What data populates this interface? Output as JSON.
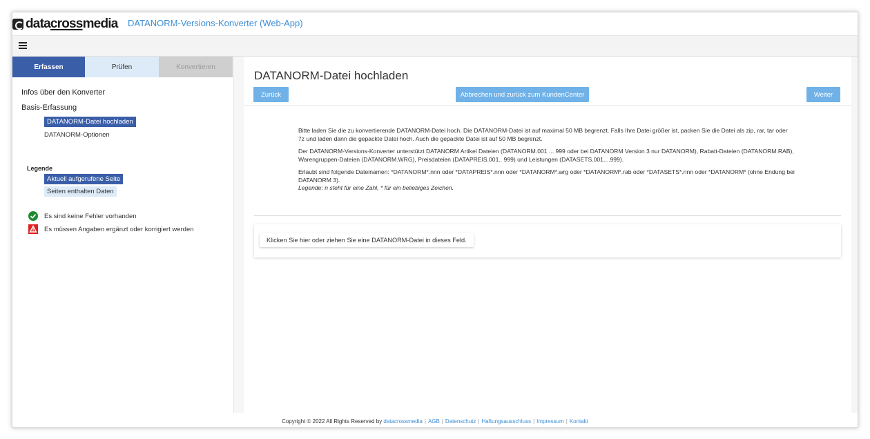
{
  "header": {
    "logo_part1": "data",
    "logo_part2": "cross",
    "logo_part3": "media",
    "app_title": "DATANORM-Versions-Konverter (Web-App)"
  },
  "sidebar": {
    "tabs": [
      {
        "label": "Erfassen",
        "state": "active"
      },
      {
        "label": "Prüfen",
        "state": "normal"
      },
      {
        "label": "Konvertieren",
        "state": "disabled"
      }
    ],
    "section1": "Infos über den Konverter",
    "section2": "Basis-Erfassung",
    "nav_active": "DATANORM-Datei hochladen",
    "nav_item": "DATANORM-Optionen",
    "legend": {
      "title": "Legende",
      "current_page": "Aktuell aufgerufene Seite",
      "pages_data": "Seiten enthalten Daten",
      "no_errors": "Es sind keine Fehler vorhanden",
      "must_fix": "Es müssen Angaben ergänzt oder korrigiert werden"
    }
  },
  "main": {
    "title": "DATANORM-Datei hochladen",
    "buttons": {
      "back": "Zurück",
      "cancel": "Abbrechen und zurück zum KundenCenter",
      "next": "Weiter"
    },
    "info": {
      "p1": "Bitte laden Sie die zu konvertierende DATANORM-Datei hoch. Die DATANORM-Datei ist auf maximal 50 MB begrenzt. Falls Ihre Datei größer ist, packen Sie die Datei als zip, rar, tar oder 7z und laden dann die gepackte Datei hoch. Auch die gepackte Datei ist auf 50 MB begrenzt.",
      "p2": "Der DATANORM-Versions-Konverter unterstützt DATANORM Artikel Dateien (DATANORM.001 ... 999 oder bei DATANORM Version 3 nur DATANORM), Rabatt-Dateien (DATANORM.RAB), Warengruppen-Dateien (DATANORM.WRG), Preisdateien (DATAPREIS.001.. 999) und Leistungen (DATASETS.001....999).",
      "p3": "Erlaubt sind folgende Dateinamen: *DATANORM*.nnn oder *DATAPREIS*.nnn oder *DATANORM*.wrg oder *DATANORM*.rab oder *DATASETS*.nnn oder *DATANORM* (ohne Endung bei DATANORM 3).",
      "p3_legend": "Legende: n steht für eine Zahl, * für ein beliebiges Zeichen."
    },
    "dropzone_label": "Klicken Sie hier oder ziehen Sie eine DATANORM-Datei in dieses Feld."
  },
  "footer": {
    "copyright": "Copyright © 2022 All Rights Reserved by",
    "links": [
      "datacrossmedia",
      "AGB",
      "Datenschutz",
      "Haftungsausschluss",
      "Impressum",
      "Kontakt"
    ]
  },
  "colors": {
    "primary_dark": "#3a5ea8",
    "button_blue": "#70b2e8",
    "link_blue": "#3c8ed6",
    "success_green": "#1e8a2e",
    "error_red": "#e02020"
  },
  "icons": {
    "menu": "hamburger-icon",
    "ok": "check-circle-icon",
    "warn": "warning-icon"
  }
}
